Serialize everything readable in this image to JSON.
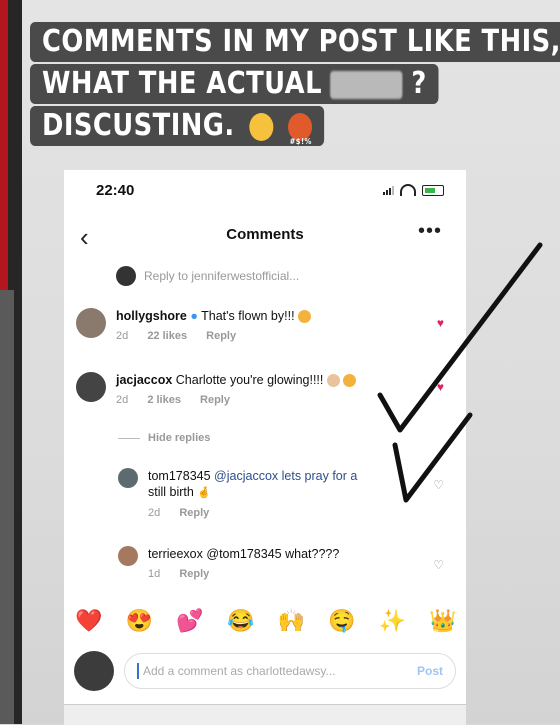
{
  "caption": {
    "line1": "COMMENTS IN MY POST LIKE THIS,",
    "line2_a": "WHAT THE ACTUAL",
    "line2_b": "?",
    "line3": "DISCUSTING."
  },
  "status": {
    "time": "22:40"
  },
  "header": {
    "title": "Comments",
    "back_icon": "chevron-left-icon",
    "more_label": "•••"
  },
  "reply_to": {
    "text": "Reply to jenniferwestofficial..."
  },
  "comments": [
    {
      "user": "hollygshore",
      "text": "That's flown by!!!",
      "time": "2d",
      "likes": "22 likes",
      "reply": "Reply",
      "verified": true
    },
    {
      "user": "jacjaccox",
      "text": "Charlotte you're glowing!!!!",
      "time": "2d",
      "likes": "2 likes",
      "reply": "Reply"
    }
  ],
  "hide_replies": "Hide replies",
  "replies": [
    {
      "user": "tom178345",
      "text_1": "@jacjaccox  lets pray for a",
      "text_2": "still birth",
      "time": "2d",
      "reply": "Reply"
    },
    {
      "user": "terrieexox",
      "text": "@tom178345 what????",
      "time": "1d",
      "reply": "Reply"
    }
  ],
  "emoji_bar": [
    "❤️",
    "😍",
    "💕",
    "😂",
    "🙌",
    "🤤",
    "✨",
    "👑"
  ],
  "composer": {
    "placeholder": "Add a comment as charlottedawsy...",
    "post": "Post"
  },
  "colors": {
    "like_red": "#e0245e",
    "link_blue": "#3a6fd8",
    "caption_bg": "#4a4a4a"
  }
}
